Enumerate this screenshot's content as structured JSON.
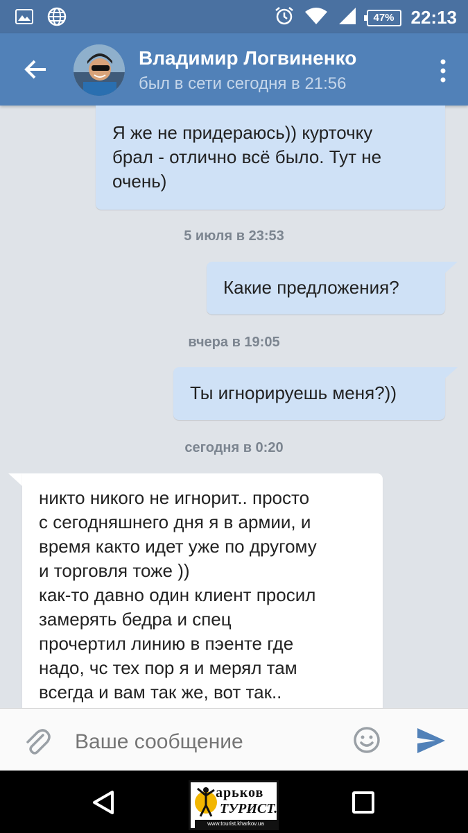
{
  "status_bar": {
    "time": "22:13",
    "battery": "47%",
    "icons": [
      "image-icon",
      "globe-icon",
      "alarm-icon",
      "wifi-icon",
      "signal-icon",
      "battery-icon"
    ]
  },
  "header": {
    "name": "Владимир Логвиненко",
    "status": "был в сети сегодня в 21:56",
    "accent": "#5181b8"
  },
  "messages": [
    {
      "direction": "out",
      "text": "Я же не придераюсь))  курточку\nбрал - отлично всё было.  Тут не\nочень)"
    },
    {
      "type": "date",
      "text": "5 июля в 23:53"
    },
    {
      "direction": "out",
      "text": "Какие предложения?"
    },
    {
      "type": "date",
      "text": "вчера в 19:05"
    },
    {
      "direction": "out",
      "text": "Ты игнорируешь меня?))"
    },
    {
      "type": "date",
      "text": "сегодня в 0:20"
    },
    {
      "direction": "in",
      "text": "никто никого не игнорит.. просто\nс сегодняшнего дня я в армии, и\nвремя както идет уже по другому\nи торговля тоже ))\nкак-то давно один клиент просил\nзамерять бедра и спец\nпрочертил линию в пэенте где\nнадо, чс тех пор я и мерял там\nвсегда и вам так же, вот так.."
    }
  ],
  "input": {
    "placeholder": "Ваше сообщение"
  },
  "watermark": {
    "line1": "арьков",
    "line2": "ТУРИСТ.",
    "url": "www.tourist.kharkov.ua"
  },
  "colors": {
    "outgoing_bubble": "#cfe1f6",
    "incoming_bubble": "#ffffff",
    "chat_background": "#dfe3e8",
    "send_icon": "#5181b8"
  }
}
